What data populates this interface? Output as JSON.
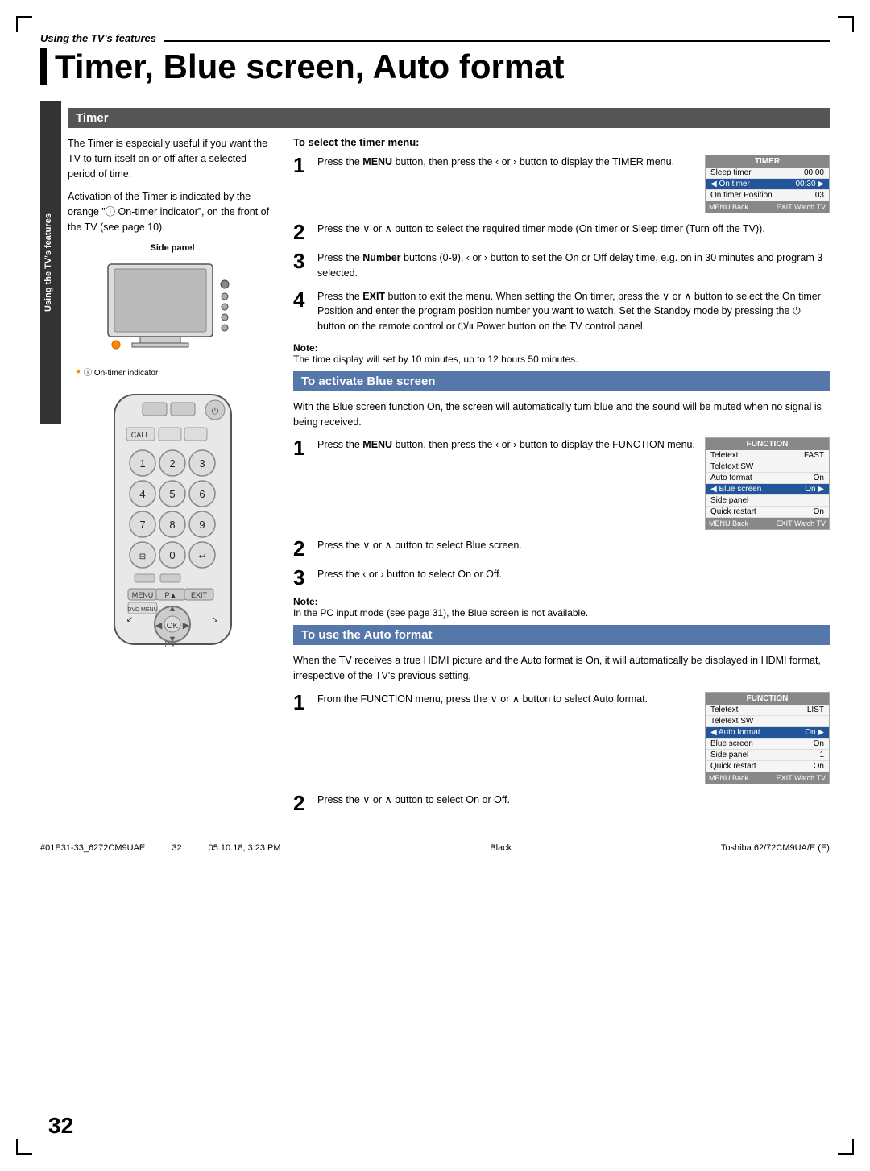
{
  "header": {
    "section_label": "Using the TV's features",
    "title": "Timer, Blue screen, Auto format"
  },
  "sidebar": {
    "label": "Using the TV's features"
  },
  "timer_section": {
    "title": "Timer",
    "description_1": "The Timer is especially useful if you want the TV to turn itself on or off after a selected period of time.",
    "description_2": "Activation of the Timer is indicated by the orange ”ⓘ On-timer indicator”, on the front of the TV (see page 10).",
    "side_panel_label": "Side panel",
    "on_timer_label": "ⓘ On-timer indicator",
    "menu_title": "TIMER",
    "menu_rows": [
      {
        "label": "Sleep timer",
        "value": "00:00",
        "selected": false
      },
      {
        "label": "On timer",
        "value": "00:30",
        "selected": true
      },
      {
        "label": "On timer Position",
        "value": "03",
        "selected": false
      }
    ],
    "to_select_title": "To select the timer menu:",
    "steps": [
      {
        "num": "1",
        "text": "Press the MENU button, then press the ‹ or › button to display the TIMER menu."
      },
      {
        "num": "2",
        "text": "Press the ∨ or ∧ button to select the required timer mode (On timer or Sleep timer (Turn off the TV))."
      },
      {
        "num": "3",
        "text": "Press the Number buttons (0-9), ‹ or › button to set the On or Off delay time, e.g. on in 30 minutes and program 3 selected."
      },
      {
        "num": "4",
        "text": "Press the EXIT button to exit the menu. When setting the On timer, press the ∨ or ∧ button to select the On timer Position and enter the program position number you want to watch. Set the Standby mode by pressing the ⏻ button on the remote control or ⏻/⏸ Power button on the TV control panel."
      }
    ],
    "note_title": "Note:",
    "note_text": "The time display will set by 10 minutes, up to 12 hours 50 minutes."
  },
  "blue_screen_section": {
    "title": "To activate Blue screen",
    "description": "With the Blue screen function On, the screen will automatically turn blue and the sound will be muted when no signal is being received.",
    "menu_title": "FUNCTION",
    "menu_rows": [
      {
        "label": "Teletext",
        "value": "FAST",
        "selected": false
      },
      {
        "label": "Teletext SW",
        "value": "",
        "selected": false
      },
      {
        "label": "Auto format",
        "value": "On",
        "selected": false
      },
      {
        "label": "Blue screen",
        "value": "On",
        "selected": true
      },
      {
        "label": "Side panel",
        "value": "",
        "selected": false
      },
      {
        "label": "Quick restart",
        "value": "On",
        "selected": false
      }
    ],
    "steps": [
      {
        "num": "1",
        "text": "Press the MENU button, then press the ‹ or › button to display the FUNCTION menu."
      },
      {
        "num": "2",
        "text": "Press the ∨ or ∧ button to select Blue screen."
      },
      {
        "num": "3",
        "text": "Press the ‹ or › button to select On or Off."
      }
    ],
    "note_title": "Note:",
    "note_text": "In the PC input mode (see page 31), the Blue screen is not available."
  },
  "auto_format_section": {
    "title": "To use the Auto format",
    "description": "When the TV receives a true HDMI picture and the Auto format is On, it will automatically be displayed in HDMI format, irrespective of the TV's previous setting.",
    "menu_title": "FUNCTION",
    "menu_rows": [
      {
        "label": "Teletext",
        "value": "LIST",
        "selected": false
      },
      {
        "label": "Teletext SW",
        "value": "",
        "selected": false
      },
      {
        "label": "Auto format",
        "value": "On",
        "selected": true
      },
      {
        "label": "Blue screen",
        "value": "On",
        "selected": false
      },
      {
        "label": "Side panel",
        "value": "1",
        "selected": false
      },
      {
        "label": "Quick restart",
        "value": "On",
        "selected": false
      }
    ],
    "steps": [
      {
        "num": "1",
        "text": "From the FUNCTION menu, press the ∨ or ∧ button to select Auto format."
      },
      {
        "num": "2",
        "text": "Press the ∨ or ∧ button to select On or Off."
      }
    ]
  },
  "footer": {
    "left": "#01E31-33_6272CM9UAE",
    "center": "32",
    "print_info": "05.10.18, 3:23 PM",
    "color": "Black",
    "model": "Toshiba 62/72CM9UA/E (E)"
  }
}
